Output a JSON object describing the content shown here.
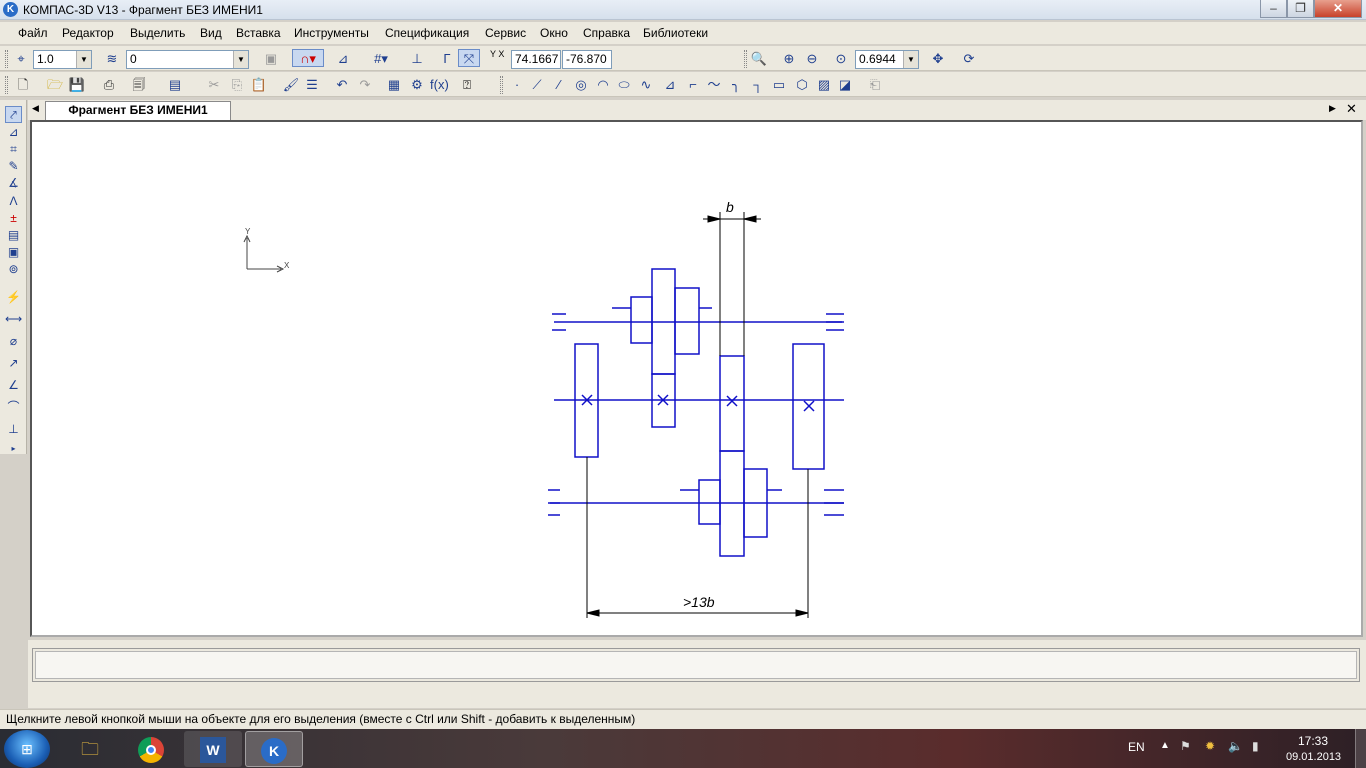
{
  "window": {
    "title": "КОМПАС-3D V13 - Фрагмент БЕЗ ИМЕНИ1",
    "app_icon": "K",
    "minimize": "–",
    "maximize": "❐",
    "close": "✕"
  },
  "menu": [
    "Файл",
    "Редактор",
    "Выделить",
    "Вид",
    "Вставка",
    "Инструменты",
    "Спецификация",
    "Сервис",
    "Окно",
    "Справка",
    "Библиотеки"
  ],
  "toolbar1": {
    "step_value": "1.0",
    "layer_value": "0",
    "coord_label": "Y X",
    "coord_x": "74.1667",
    "coord_y": "-76.870",
    "zoom_value": "0.6944"
  },
  "document": {
    "tab_label": "Фрагмент БЕЗ ИМЕНИ1"
  },
  "drawing": {
    "axis_y": "Y",
    "axis_x": "X",
    "dim_top": "b",
    "dim_bottom": ">13b",
    "line_color": "#1010c8"
  },
  "status": {
    "hint": "Щелкните левой кнопкой мыши на объекте для его выделения (вместе с Ctrl или Shift - добавить к выделенным)"
  },
  "taskbar": {
    "lang": "EN",
    "time": "17:33",
    "date": "09.01.2013"
  }
}
